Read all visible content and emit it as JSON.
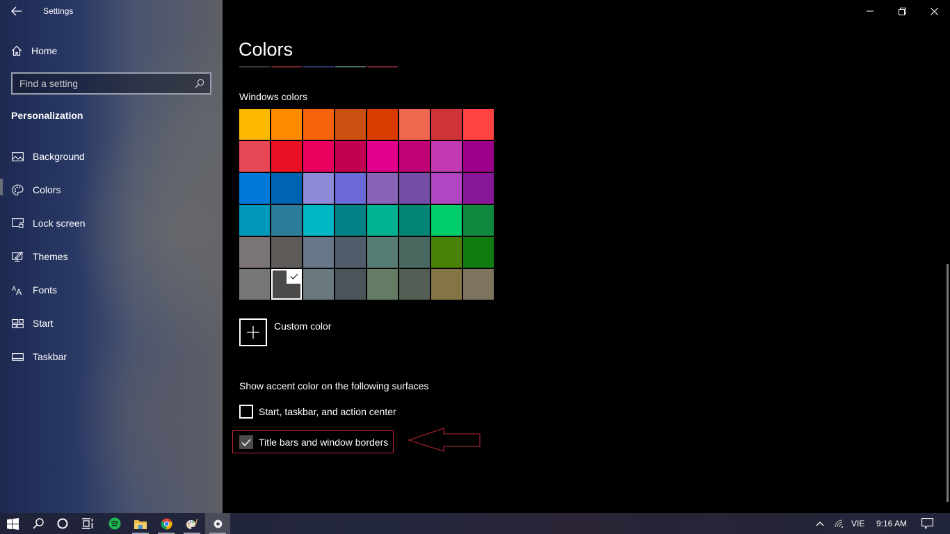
{
  "window": {
    "app_title": "Settings",
    "controls": [
      "minimize",
      "restore",
      "close"
    ]
  },
  "sidebar": {
    "home_label": "Home",
    "search": {
      "placeholder": "Find a setting",
      "value": ""
    },
    "section_title": "Personalization",
    "items": [
      {
        "label": "Background",
        "icon": "picture-icon",
        "selected": false
      },
      {
        "label": "Colors",
        "icon": "palette-icon",
        "selected": true
      },
      {
        "label": "Lock screen",
        "icon": "lock-screen-icon",
        "selected": false
      },
      {
        "label": "Themes",
        "icon": "themes-icon",
        "selected": false
      },
      {
        "label": "Fonts",
        "icon": "fonts-icon",
        "selected": false
      },
      {
        "label": "Start",
        "icon": "start-icon",
        "selected": false
      },
      {
        "label": "Taskbar",
        "icon": "taskbar-icon",
        "selected": false
      }
    ]
  },
  "main": {
    "page_title": "Colors",
    "accent_strip_colors": [
      "#3a3a3a",
      "#7a2226",
      "#2a3a6a",
      "#4a6a60",
      "#7a2030"
    ],
    "windows_colors_label": "Windows colors",
    "swatches": [
      [
        "#ffb900",
        "#ff8c00",
        "#f7630c",
        "#ca5010",
        "#da3b01",
        "#ef6950",
        "#d13438",
        "#ff4343"
      ],
      [
        "#e74856",
        "#e81123",
        "#ea005e",
        "#c30052",
        "#e3008c",
        "#bf0077",
        "#c239b3",
        "#9a0089"
      ],
      [
        "#0078d7",
        "#0063b1",
        "#8e8cd8",
        "#6b69d6",
        "#8764b8",
        "#744da9",
        "#b146c2",
        "#881798"
      ],
      [
        "#0099bc",
        "#2d7d9a",
        "#00b7c3",
        "#038387",
        "#00b294",
        "#018574",
        "#00cc6a",
        "#10893e"
      ],
      [
        "#7a7574",
        "#5d5a58",
        "#68768a",
        "#515c6b",
        "#567c73",
        "#486860",
        "#498205",
        "#107c10"
      ],
      [
        "#767676",
        "#4c4a48",
        "#69797e",
        "#4a5459",
        "#647c64",
        "#525e54",
        "#847545",
        "#7e735f"
      ]
    ],
    "selected_swatch": {
      "row": 5,
      "col": 1
    },
    "custom_color_label": "Custom color",
    "surfaces_label": "Show accent color on the following surfaces",
    "checkboxes": [
      {
        "label": "Start, taskbar, and action center",
        "checked": false
      },
      {
        "label": "Title bars and window borders",
        "checked": true
      }
    ],
    "annotation_color": "#c0283a"
  },
  "taskbar": {
    "apps": [
      {
        "name": "start",
        "icon": "windows-logo-icon",
        "open": false
      },
      {
        "name": "search",
        "icon": "search-icon",
        "open": false
      },
      {
        "name": "cortana",
        "icon": "cortana-icon",
        "open": false
      },
      {
        "name": "task-view",
        "icon": "task-view-icon",
        "open": false
      },
      {
        "name": "spotify",
        "icon": "spotify-icon",
        "open": false
      },
      {
        "name": "file-explorer",
        "icon": "folder-icon",
        "open": true
      },
      {
        "name": "chrome",
        "icon": "chrome-icon",
        "open": true
      },
      {
        "name": "paint",
        "icon": "paint-palette-icon",
        "open": true
      },
      {
        "name": "settings",
        "icon": "gear-icon",
        "open": true,
        "active": true
      }
    ],
    "tray": {
      "language": "VIE",
      "time": "9:16 AM"
    }
  }
}
